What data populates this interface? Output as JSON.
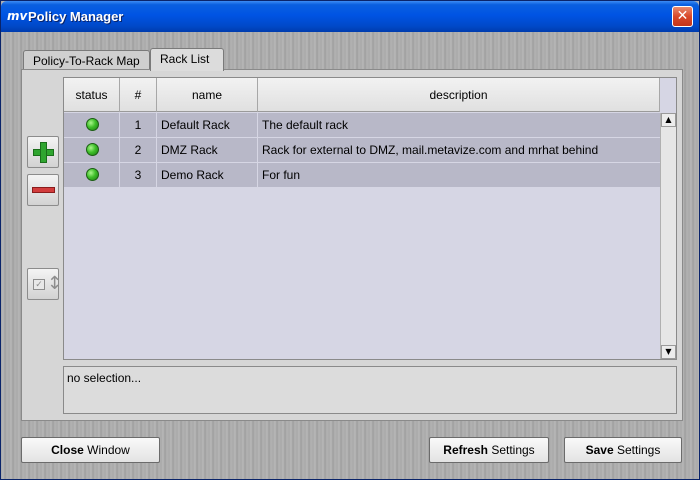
{
  "window": {
    "title": "Policy Manager",
    "close_glyph": "✕"
  },
  "tabs": [
    {
      "label": "Policy-To-Rack Map",
      "active": false
    },
    {
      "label": "Rack List",
      "active": true
    }
  ],
  "toolbar": {
    "add_icon": "plus-icon",
    "remove_icon": "minus-icon",
    "move_icon": "move-checkbox-icon"
  },
  "table": {
    "columns": [
      "status",
      "#",
      "name",
      "description"
    ],
    "rows": [
      {
        "status": "green",
        "num": "1",
        "name": "Default Rack",
        "description": "The default rack"
      },
      {
        "status": "green",
        "num": "2",
        "name": "DMZ Rack",
        "description": "Rack for external to DMZ, mail.metavize.com and mrhat behind"
      },
      {
        "status": "green",
        "num": "3",
        "name": "Demo Rack",
        "description": "For fun"
      }
    ]
  },
  "status_text": "no selection...",
  "buttons": {
    "close": {
      "bold": "Close",
      "rest": " Window"
    },
    "refresh": {
      "bold": "Refresh",
      "rest": " Settings"
    },
    "save": {
      "bold": "Save",
      "rest": " Settings"
    }
  },
  "colors": {
    "titlebar": "#0054e3",
    "row_bg": "#b8b8c8",
    "status_green": "#3fbf2a"
  }
}
